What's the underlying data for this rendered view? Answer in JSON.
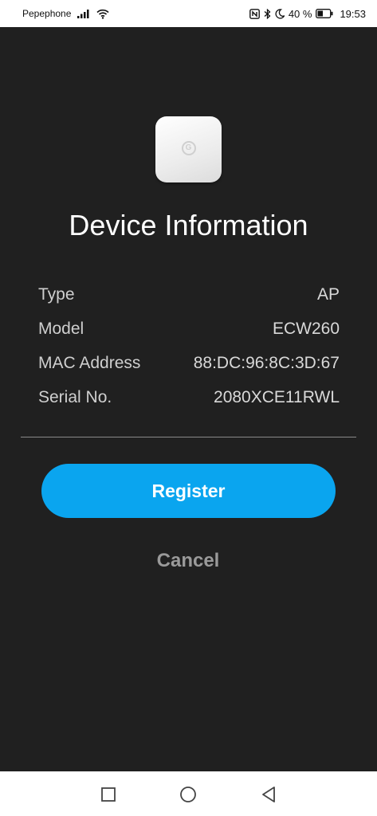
{
  "status_bar": {
    "carrier": "Pepephone",
    "battery_percent": "40 %",
    "time": "19:53",
    "icons": [
      "signal-icon",
      "wifi-icon",
      "nfc-icon",
      "bluetooth-icon",
      "do-not-disturb-icon",
      "battery-icon"
    ]
  },
  "device_info": {
    "title": "Device Information",
    "rows": [
      {
        "label": "Type",
        "value": "AP"
      },
      {
        "label": "Model",
        "value": "ECW260"
      },
      {
        "label": "MAC Address",
        "value": "88:DC:96:8C:3D:67"
      },
      {
        "label": "Serial No.",
        "value": "2080XCE11RWL"
      }
    ]
  },
  "actions": {
    "register_label": "Register",
    "cancel_label": "Cancel"
  },
  "nav_bar": {
    "icons": [
      "recent-apps-icon",
      "home-icon",
      "back-icon"
    ]
  },
  "colors": {
    "background": "#202020",
    "accent": "#0aa5ef"
  }
}
